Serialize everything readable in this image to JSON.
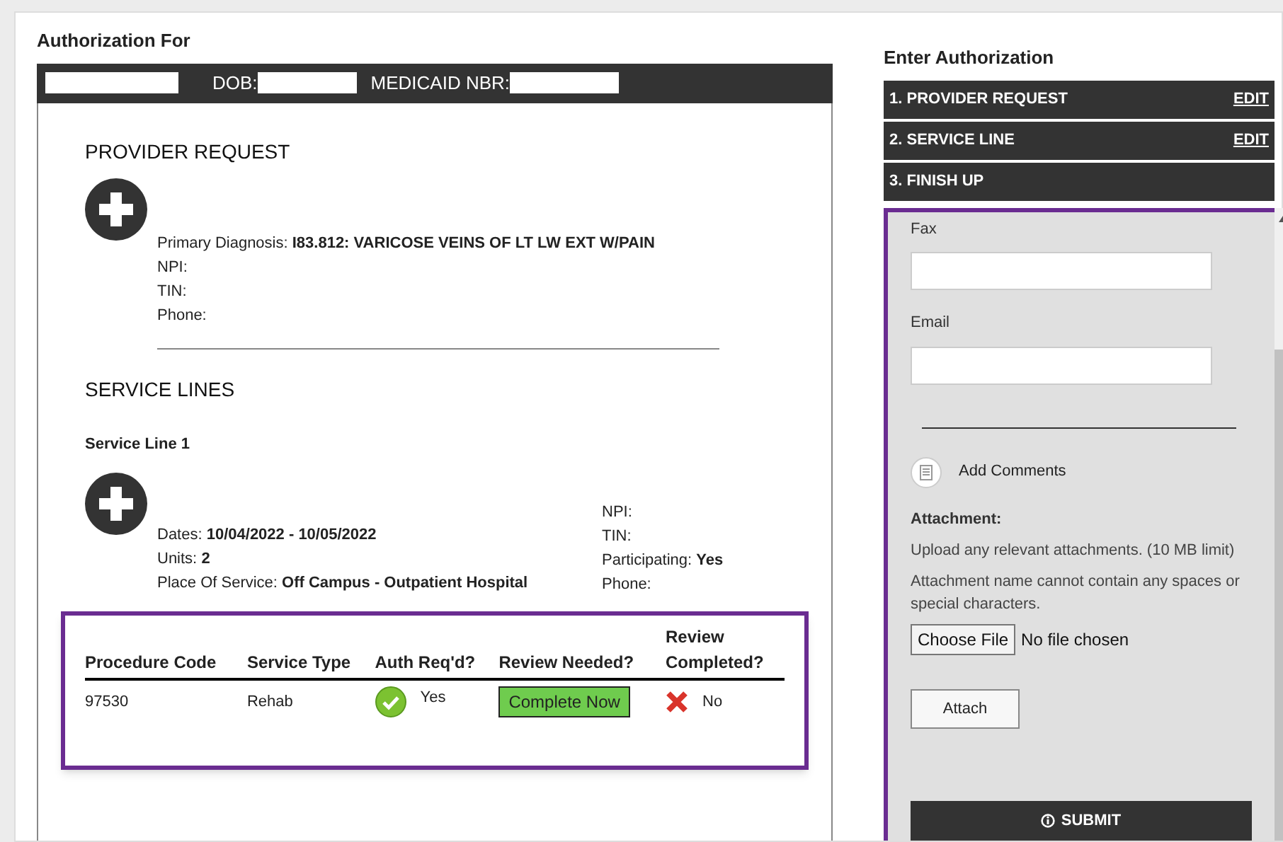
{
  "authorization_for": {
    "title": "Authorization For",
    "dob_label": "DOB:",
    "medicaid_label": "MEDICAID NBR:"
  },
  "provider_request": {
    "heading": "PROVIDER REQUEST",
    "lines": [
      "Primary Diagnosis: **I83.812: VARICOSE VEINS OF LT LW EXT W/PAIN**",
      "NPI:",
      "TIN:",
      "Phone:"
    ]
  },
  "service_lines": {
    "heading": "SERVICE LINES",
    "line_title": "Service Line 1",
    "details_left": [
      "Dates: **10/04/2022 - 10/05/2022**",
      "Units: **2**",
      "Place Of Service: **Off Campus - Outpatient Hospital**"
    ],
    "details_right": [
      "NPI:",
      "TIN:",
      "Participating: **Yes**",
      "Phone:"
    ]
  },
  "table": {
    "columns": [
      "Procedure Code",
      "Service Type",
      "Auth Req'd?",
      "Review Needed?",
      "Review Completed?"
    ],
    "rows": [
      {
        "procedure_code": "97530",
        "service_type": "Rehab",
        "auth_required": {
          "kind": "check",
          "text": "Yes"
        },
        "review_needed": {
          "button": "Complete Now"
        },
        "review_completed": {
          "kind": "cross",
          "text": "No"
        }
      }
    ]
  },
  "enter_authorization": {
    "title": "Enter Authorization",
    "steps": [
      {
        "label": "1. PROVIDER REQUEST",
        "action": "EDIT"
      },
      {
        "label": "2. SERVICE LINE",
        "action": "EDIT"
      },
      {
        "label": "3. FINISH UP"
      }
    ]
  },
  "finish_up": {
    "fax_label": "Fax",
    "email_label": "Email",
    "add_comments": "Add Comments",
    "attachment_label": "Attachment:",
    "attachment_notes": [
      "Upload any relevant attachments. (10 MB limit)",
      "Attachment name cannot contain any spaces or special characters."
    ],
    "choose_file": "Choose File",
    "file_status": "No file chosen",
    "attach_button": "Attach",
    "submit_button": "SUBMIT"
  }
}
